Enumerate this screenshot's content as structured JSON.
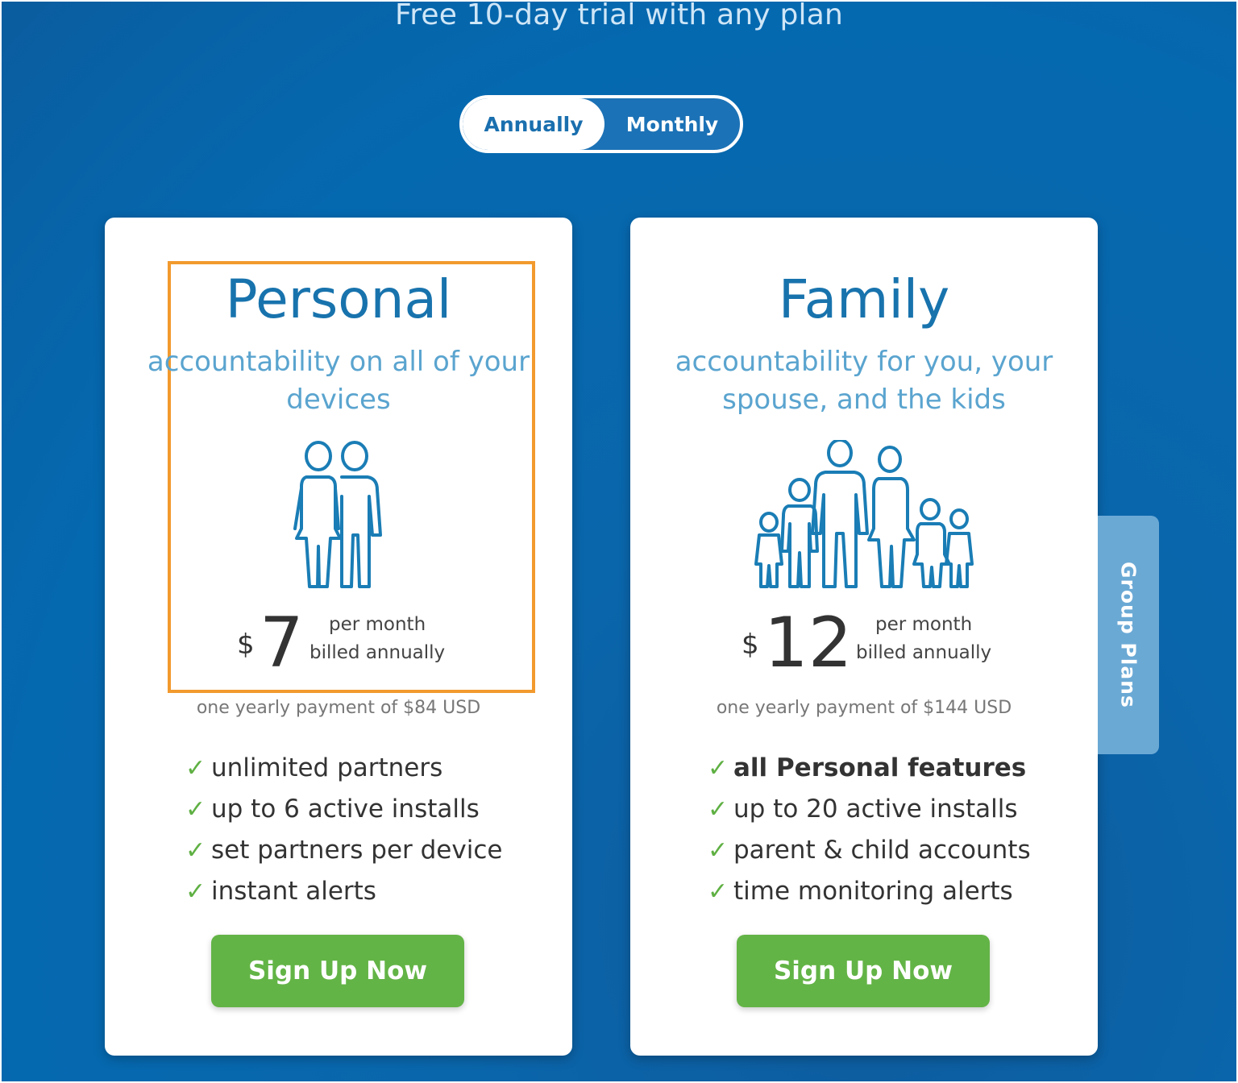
{
  "header": {
    "trial_text": "Free 10-day trial with any plan"
  },
  "billing_toggle": {
    "options": [
      "Annually",
      "Monthly"
    ],
    "selected": "Annually"
  },
  "plans": [
    {
      "name": "Personal",
      "description": "accountability on all of your devices",
      "icon": "couple-icon",
      "currency": "$",
      "price": "7",
      "price_note_line1": "per month",
      "price_note_line2": "billed annually",
      "yearly_payment": "one yearly payment of $84 USD",
      "features": [
        "unlimited partners",
        "up to 6 active installs",
        "set partners per device",
        "instant alerts"
      ],
      "cta": "Sign Up Now"
    },
    {
      "name": "Family",
      "description": "accountability for you, your spouse, and the kids",
      "icon": "family-icon",
      "currency": "$",
      "price": "12",
      "price_note_line1": "per month",
      "price_note_line2": "billed annually",
      "yearly_payment": "one yearly payment of $144 USD",
      "features": [
        "all Personal features",
        "up to 20 active installs",
        "parent & child accounts",
        "time monitoring alerts"
      ],
      "cta": "Sign Up Now"
    }
  ],
  "group_tab": {
    "label": "Group Plans"
  },
  "colors": {
    "background": "#0569b0",
    "accent_blue": "#1873ad",
    "highlight": "#f29a2e",
    "cta_green": "#63b446",
    "check_green": "#5fb043"
  }
}
